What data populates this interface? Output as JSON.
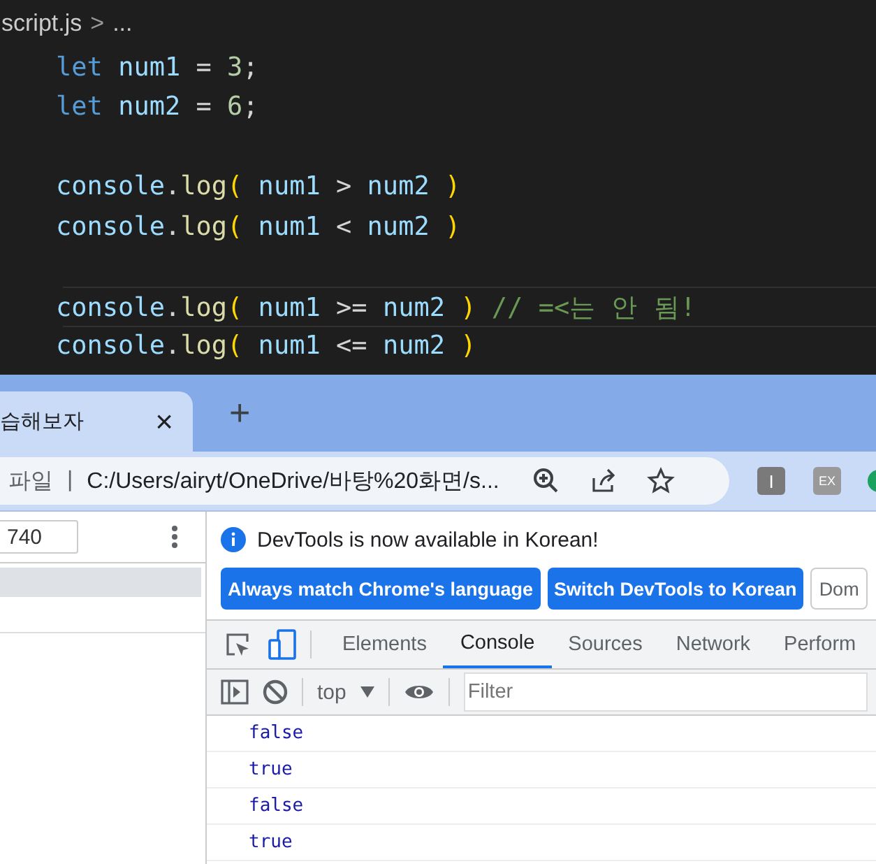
{
  "editor": {
    "breadcrumb": "script.js",
    "breadcrumb_separator": ">",
    "breadcrumb_more": "...",
    "lines": [
      {
        "selected": false,
        "tokens": [
          {
            "kind": "keyword",
            "text": "let "
          },
          {
            "kind": "var",
            "text": "num1"
          },
          {
            "kind": "plain",
            "text": " = "
          },
          {
            "kind": "num",
            "text": "3"
          },
          {
            "kind": "plain",
            "text": ";"
          }
        ]
      },
      {
        "selected": false,
        "tokens": [
          {
            "kind": "keyword",
            "text": "let "
          },
          {
            "kind": "var",
            "text": "num2"
          },
          {
            "kind": "plain",
            "text": " = "
          },
          {
            "kind": "num",
            "text": "6"
          },
          {
            "kind": "plain",
            "text": ";"
          }
        ]
      },
      {
        "selected": false
      },
      {
        "selected": false,
        "tokens": [
          {
            "kind": "var",
            "text": "console"
          },
          {
            "kind": "plain",
            "text": "."
          },
          {
            "kind": "fn",
            "text": "log"
          },
          {
            "kind": "paren",
            "text": "("
          },
          {
            "kind": "var",
            "text": " num1"
          },
          {
            "kind": "plain",
            "text": " > "
          },
          {
            "kind": "var",
            "text": "num2"
          },
          {
            "kind": "paren",
            "text": " )"
          }
        ]
      },
      {
        "selected": false,
        "tokens": [
          {
            "kind": "var",
            "text": "console"
          },
          {
            "kind": "plain",
            "text": "."
          },
          {
            "kind": "fn",
            "text": "log"
          },
          {
            "kind": "paren",
            "text": "("
          },
          {
            "kind": "var",
            "text": " num1"
          },
          {
            "kind": "plain",
            "text": " < "
          },
          {
            "kind": "var",
            "text": "num2"
          },
          {
            "kind": "paren",
            "text": " )"
          }
        ]
      },
      {
        "selected": false
      },
      {
        "selected": true,
        "tokens": [
          {
            "kind": "var",
            "text": "console"
          },
          {
            "kind": "plain",
            "text": "."
          },
          {
            "kind": "fn",
            "text": "log"
          },
          {
            "kind": "paren",
            "text": "("
          },
          {
            "kind": "var",
            "text": " num1"
          },
          {
            "kind": "plain",
            "text": " >= "
          },
          {
            "kind": "var",
            "text": "num2"
          },
          {
            "kind": "paren",
            "text": " )"
          },
          {
            "kind": "comment",
            "text": " // =<는 안 됨!"
          }
        ]
      },
      {
        "selected": false,
        "tokens": [
          {
            "kind": "var",
            "text": "console"
          },
          {
            "kind": "plain",
            "text": "."
          },
          {
            "kind": "fn",
            "text": "log"
          },
          {
            "kind": "paren",
            "text": "("
          },
          {
            "kind": "var",
            "text": " num1"
          },
          {
            "kind": "plain",
            "text": " <= "
          },
          {
            "kind": "var",
            "text": "num2"
          },
          {
            "kind": "paren",
            "text": " )"
          }
        ]
      }
    ]
  },
  "browser": {
    "tab": {
      "title": "습해보자",
      "close": "×"
    },
    "new_tab": "+",
    "address": {
      "scheme_label": "파일",
      "separator": "|",
      "url": "C:/Users/airyt/OneDrive/바탕%20화면/s..."
    },
    "extensions": [
      "I",
      "EX"
    ]
  },
  "page": {
    "width_field": "740"
  },
  "devtools": {
    "infobar": "DevTools is now available in Korean!",
    "buttons": [
      {
        "label": "Always match Chrome's language",
        "kind": "primary"
      },
      {
        "label": "Switch DevTools to Korean",
        "kind": "primary"
      },
      {
        "label": "Dom",
        "kind": "secondary"
      }
    ],
    "tabs": [
      {
        "label": "Elements",
        "selected": false
      },
      {
        "label": "Console",
        "selected": true
      },
      {
        "label": "Sources",
        "selected": false
      },
      {
        "label": "Network",
        "selected": false
      },
      {
        "label": "Perform",
        "selected": false
      }
    ],
    "context": "top",
    "filter": {
      "placeholder": "Filter"
    },
    "output": [
      "false",
      "true",
      "false",
      "true"
    ]
  }
}
